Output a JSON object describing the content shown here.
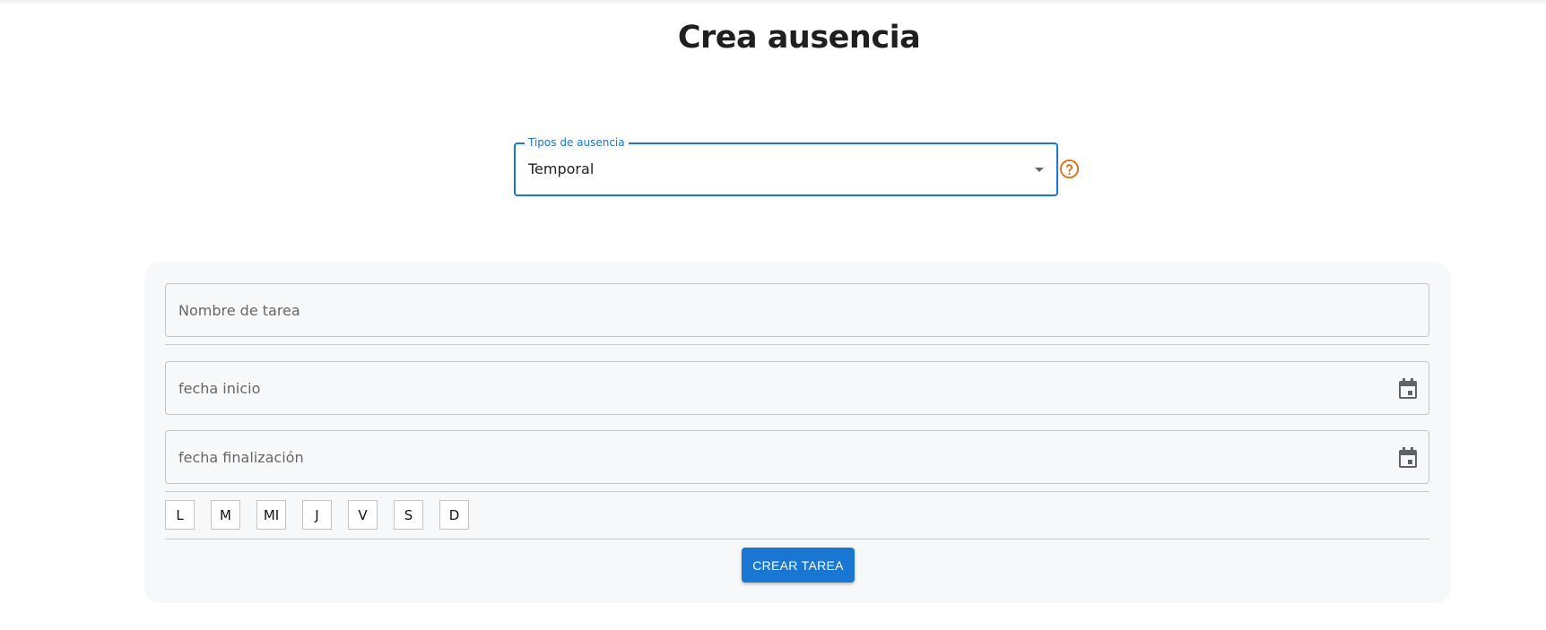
{
  "page": {
    "title": "Crea ausencia"
  },
  "absence_type": {
    "label": "Tipos de ausencia",
    "value": "Temporal",
    "help_icon": "help-circle-icon",
    "accent_color": "#1976d2",
    "help_color": "#e0711c"
  },
  "form": {
    "task_name_placeholder": "Nombre de tarea",
    "start_date_placeholder": "fecha inicio",
    "end_date_placeholder": "fecha finalización",
    "calendar_icon": "calendar-icon",
    "days": [
      "L",
      "M",
      "MI",
      "J",
      "V",
      "S",
      "D"
    ],
    "submit_label": "CREAR TAREA"
  }
}
